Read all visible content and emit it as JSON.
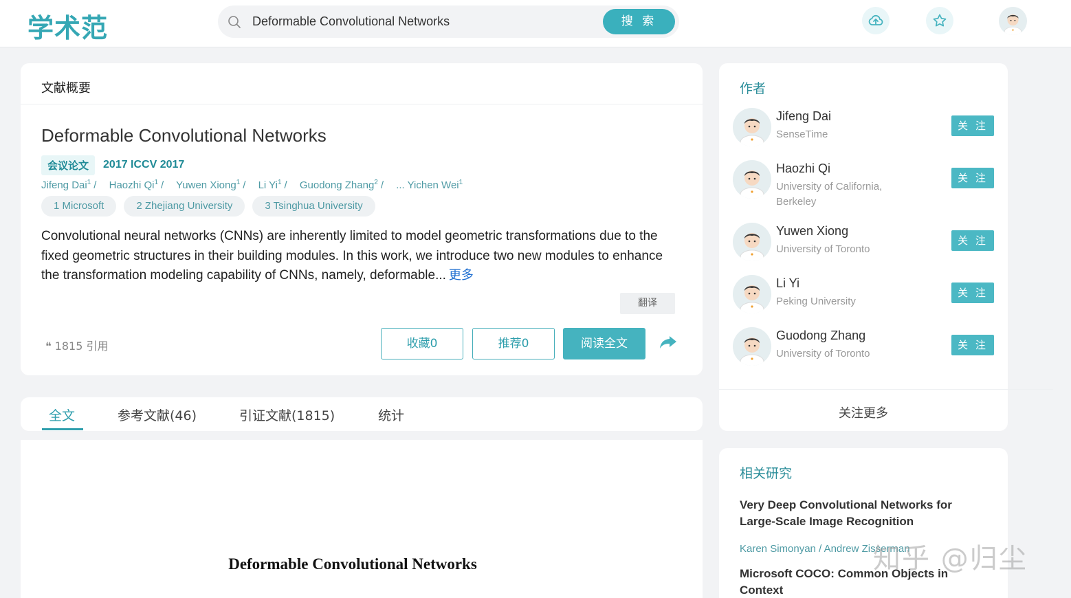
{
  "header": {
    "logo": "学术范",
    "search_value": "Deformable Convolutional Networks",
    "search_button": "搜 索",
    "icons": [
      "cloud-upload-icon",
      "star-icon",
      "user-avatar"
    ]
  },
  "summary": {
    "card_title": "文献概要",
    "paper_title": "Deformable Convolutional Networks",
    "type_tag": "会议论文",
    "venue": "2017  ICCV 2017",
    "authors": [
      {
        "name": "Jifeng Dai",
        "sup": "1"
      },
      {
        "name": "Haozhi Qi",
        "sup": "1"
      },
      {
        "name": "Yuwen Xiong",
        "sup": "1"
      },
      {
        "name": "Li Yi",
        "sup": "1"
      },
      {
        "name": "Guodong Zhang",
        "sup": "2"
      },
      {
        "name": "... Yichen Wei",
        "sup": "1"
      }
    ],
    "separator": "/",
    "affiliations": [
      "1 Microsoft",
      "2 Zhejiang University",
      "3 Tsinghua University"
    ],
    "abstract": "Convolutional neural networks (CNNs) are inherently limited to model geometric transformations due to the fixed geometric structures in their building modules. In this work, we introduce two new modules to enhance the transformation modeling capability of CNNs, namely, deformable...",
    "more_link": "更多",
    "translate": "翻译",
    "citations": "❝ 1815 引用",
    "collect_button": "收藏0",
    "recommend_button": "推荐0",
    "read_button": "阅读全文"
  },
  "tabs": {
    "items": [
      "全文",
      "参考文献(46)",
      "引证文献(1815)",
      "统计"
    ],
    "active": "全文"
  },
  "fulltext": {
    "title": "Deformable Convolutional Networks"
  },
  "authors_panel": {
    "title": "作者",
    "follow_label": "关 注",
    "items": [
      {
        "name": "Jifeng Dai",
        "org": "SenseTime"
      },
      {
        "name": "Haozhi Qi",
        "org": "University of California, Berkeley"
      },
      {
        "name": "Yuwen Xiong",
        "org": "University of Toronto"
      },
      {
        "name": "Li Yi",
        "org": "Peking University"
      },
      {
        "name": "Guodong Zhang",
        "org": "University of Toronto"
      }
    ],
    "follow_more": "关注更多"
  },
  "related": {
    "title": "相关研究",
    "items": [
      {
        "title": "Very Deep Convolutional Networks for Large-Scale Image Recognition",
        "authors": "Karen Simonyan  /  Andrew Zisserman"
      },
      {
        "title": "Microsoft COCO: Common Objects in Context"
      }
    ]
  },
  "watermark": "知乎 @归尘",
  "colors": {
    "accent": "#3ab0bd",
    "accent_dark": "#2e9eac",
    "link_blue": "#1f6fd1",
    "background": "#f2f3f5"
  }
}
